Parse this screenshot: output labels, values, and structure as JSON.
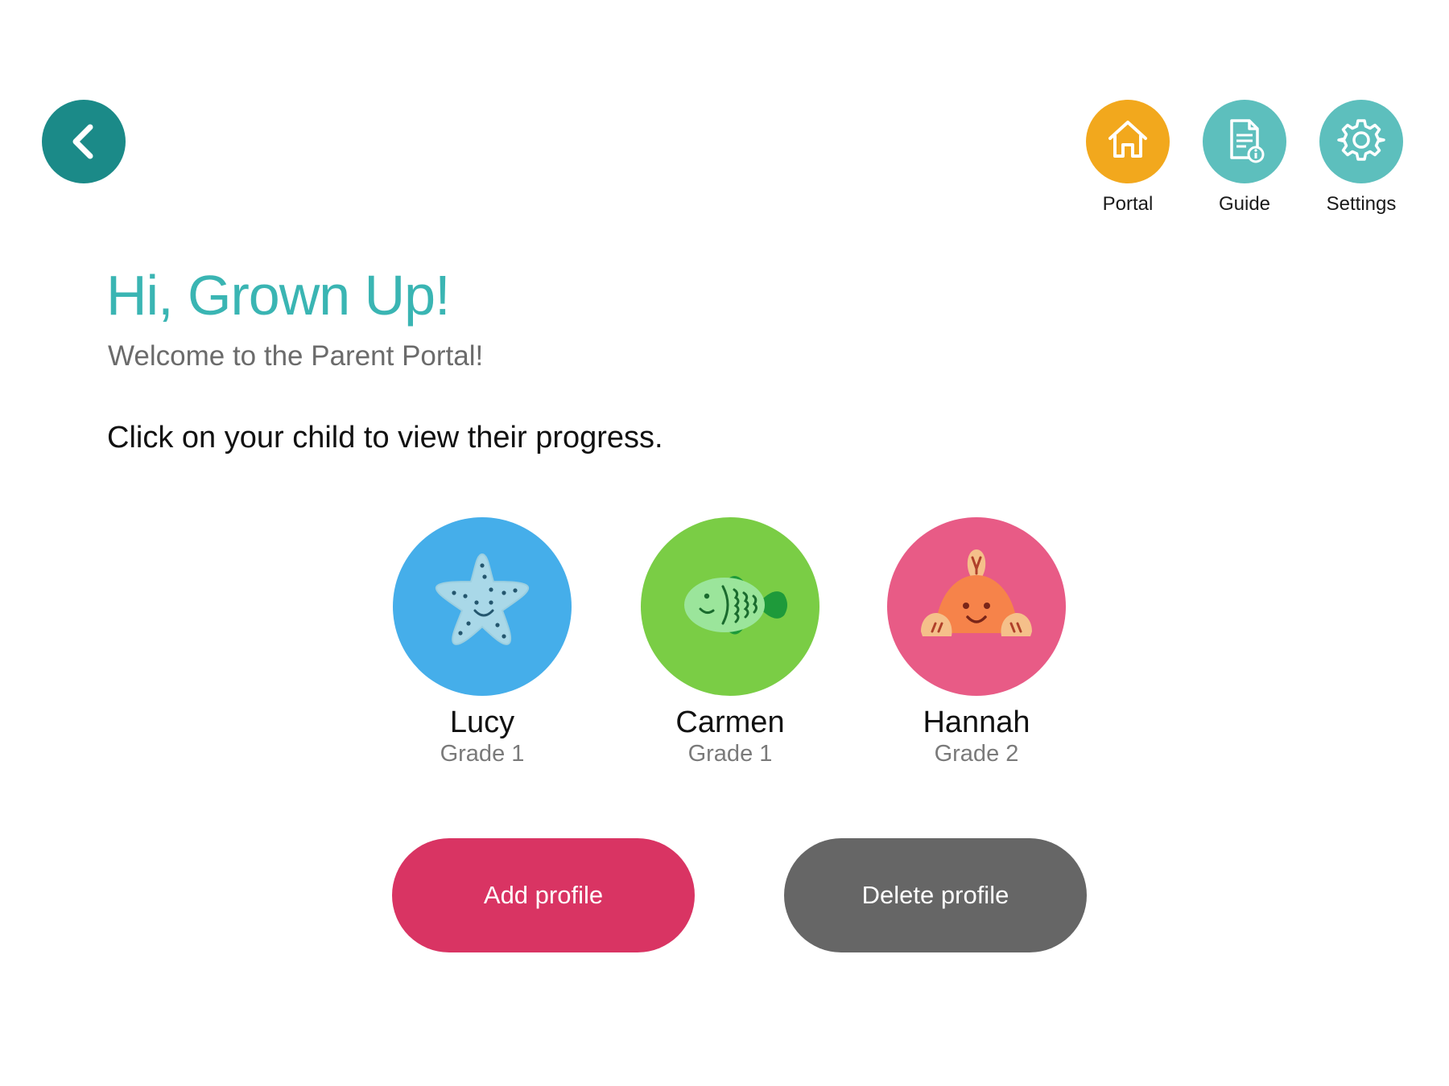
{
  "nav": {
    "back_icon": "chevron-left-icon",
    "items": [
      {
        "label": "Portal",
        "icon": "home-icon",
        "color": "#f2a81d"
      },
      {
        "label": "Guide",
        "icon": "document-info-icon",
        "color": "#5dbfbd"
      },
      {
        "label": "Settings",
        "icon": "gear-icon",
        "color": "#5dbfbd"
      }
    ]
  },
  "header": {
    "greeting": "Hi, Grown Up!",
    "subtitle": "Welcome to the Parent Portal!",
    "instruction": "Click on your child to view their progress."
  },
  "children": [
    {
      "name": "Lucy",
      "grade": "Grade 1",
      "avatar_icon": "starfish-icon",
      "color": "#45aeea"
    },
    {
      "name": "Carmen",
      "grade": "Grade 1",
      "avatar_icon": "fish-icon",
      "color": "#7acd45"
    },
    {
      "name": "Hannah",
      "grade": "Grade 2",
      "avatar_icon": "crab-icon",
      "color": "#e85b86"
    }
  ],
  "actions": {
    "add_label": "Add profile",
    "delete_label": "Delete profile"
  },
  "colors": {
    "back_button": "#1b8a88",
    "greeting_text": "#3ab5b3",
    "add_button": "#d93463",
    "delete_button": "#666666"
  }
}
